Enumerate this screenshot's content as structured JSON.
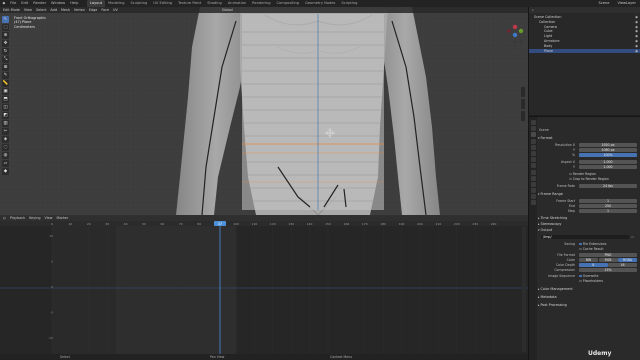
{
  "menu": [
    "File",
    "Edit",
    "Render",
    "Window",
    "Help"
  ],
  "workspaces": [
    "Layout",
    "Modeling",
    "Sculpting",
    "UV Editing",
    "Texture Paint",
    "Shading",
    "Animation",
    "Rendering",
    "Compositing",
    "Geometry Nodes",
    "Scripting"
  ],
  "active_workspace_index": 0,
  "top_right": {
    "scene": "Scene",
    "view_layer": "ViewLayer"
  },
  "viewport": {
    "header": [
      "Edit Mode",
      "View",
      "Select",
      "Add",
      "Mesh",
      "Vertex",
      "Edge",
      "Face",
      "UV",
      "Global"
    ],
    "info": [
      "Front Orthographic",
      "(47) Plane",
      "Centimeters"
    ],
    "toolbar_icons": [
      "cursor-icon",
      "select-box-icon",
      "cursor-3d-icon",
      "move-icon",
      "rotate-icon",
      "scale-icon",
      "transform-icon",
      "annotate-icon",
      "measure-icon",
      "add-cube-icon",
      "extrude-icon",
      "inset-icon",
      "bevel-icon",
      "loop-cut-icon",
      "knife-icon",
      "poly-build-icon",
      "spin-icon",
      "smooth-icon",
      "shear-icon",
      "rip-icon"
    ],
    "colors": {
      "background": "#3d3d3d",
      "grid": "#444444",
      "reference": "#a6a6a6",
      "plane": "#c7c7c7",
      "edge_orange": "#e88a3c",
      "edge_dark": "#232323"
    }
  },
  "timeline": {
    "header": [
      "Playback",
      "Keying",
      "View",
      "Marker"
    ],
    "frame_current": "47",
    "ruler": [
      "0",
      "10",
      "20",
      "30",
      "40",
      "50",
      "60",
      "70",
      "80",
      "90",
      "100",
      "110",
      "120",
      "130",
      "140",
      "150",
      "160",
      "170",
      "180",
      "190",
      "200",
      "210",
      "220",
      "230",
      "240"
    ],
    "row_labels": [
      "10",
      "5",
      "0",
      "-5",
      "-10"
    ],
    "status": [
      "Select",
      "Pan View",
      "Context Menu"
    ],
    "accent": "#4b90d8"
  },
  "outliner": {
    "rows": [
      {
        "label": "Scene Collection",
        "indent": 1,
        "selected": false
      },
      {
        "label": "Collection",
        "indent": 2,
        "selected": false
      },
      {
        "label": "Camera",
        "indent": 3,
        "selected": false
      },
      {
        "label": "Cube",
        "indent": 3,
        "selected": false
      },
      {
        "label": "Light",
        "indent": 3,
        "selected": false
      },
      {
        "label": "Armature",
        "indent": 3,
        "selected": false
      },
      {
        "label": "Body",
        "indent": 3,
        "selected": false
      },
      {
        "label": "Plane",
        "indent": 3,
        "selected": true
      }
    ]
  },
  "properties": {
    "panel_title": "Scene",
    "format": {
      "title": "Format",
      "resolution_x": "1920 px",
      "resolution_y": "1080 px",
      "resolution_pct": "100%",
      "aspect_x": "1.000",
      "aspect_y": "1.000",
      "render_region": "Render Region",
      "crop_region": "Crop to Render Region",
      "frame_rate": "24 fps"
    },
    "frame_range": {
      "title": "Frame Range",
      "start": "1",
      "end": "250",
      "step": "1"
    },
    "time_stretching": "Time Stretching",
    "stereoscopy": "Stereoscopy",
    "output": {
      "title": "Output",
      "path": "/tmp/",
      "saving": "File Extensions",
      "cache": "Cache Result",
      "file_format": "PNG",
      "color": [
        "BW",
        "RGB",
        "RGBA"
      ],
      "color_depth": [
        "8",
        "16"
      ],
      "compression": "15%",
      "image_sequence": "Overwrite",
      "placeholders": "Placeholders"
    },
    "collapsed": [
      "Color Management",
      "Metadata",
      "Post Processing"
    ]
  },
  "watermark": "Udemy"
}
